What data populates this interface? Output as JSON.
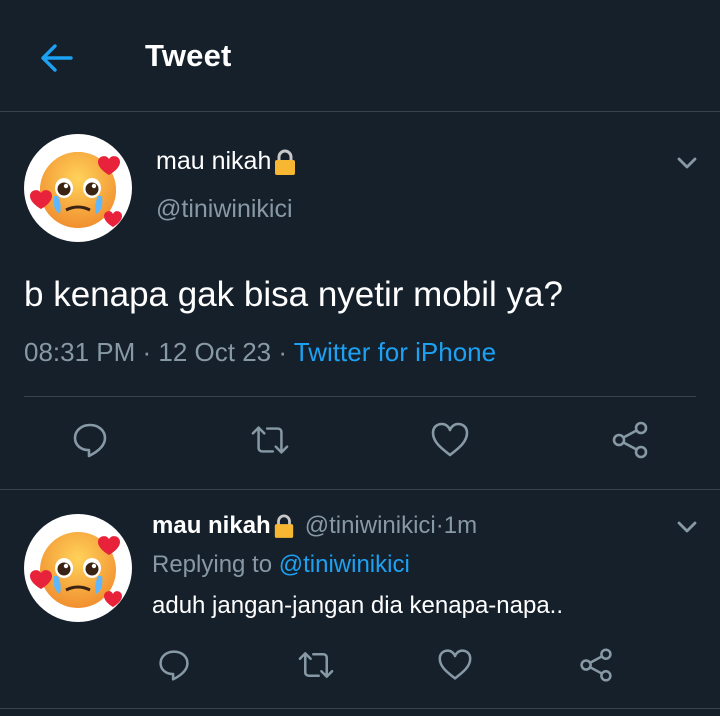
{
  "header": {
    "title": "Tweet",
    "back_icon": "arrow-left-icon",
    "accent": "#1da1f2"
  },
  "tweet": {
    "name": "mau nikah",
    "handle": "@tiniwinikici",
    "text": "b kenapa gak bisa nyetir mobil ya?",
    "time": "08:31 PM",
    "date": "12 Oct 23",
    "separator": " · ",
    "source": "Twitter for iPhone",
    "avatar_icon": "pleading-face-hearts-emoji",
    "actions": [
      "reply-icon",
      "retweet-icon",
      "like-icon",
      "share-icon"
    ]
  },
  "reply": {
    "name": "mau nikah",
    "handle": "@tiniwinikici",
    "time": "1m",
    "separator": " · ",
    "replying_prefix": "Replying to ",
    "replying_handle": "@tiniwinikici",
    "text": "aduh jangan-jangan dia kenapa-napa..",
    "actions": [
      "reply-icon",
      "retweet-icon",
      "like-icon",
      "share-icon"
    ]
  },
  "colors": {
    "background": "#15202b",
    "muted": "#8899a6",
    "divider": "#38444d",
    "link": "#1da1f2"
  }
}
